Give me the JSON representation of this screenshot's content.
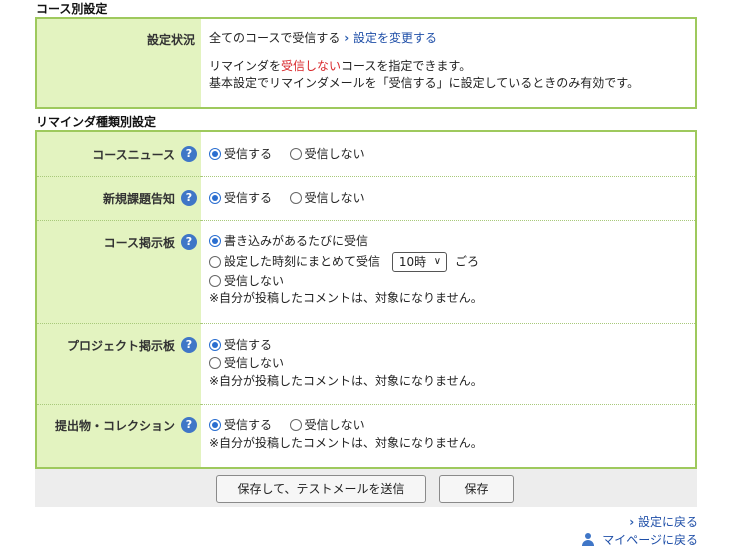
{
  "course_section": {
    "title": "コース別設定",
    "status_label": "設定状況",
    "status_value": "全てのコースで受信する",
    "change_link": "設定を変更する",
    "note1_pre": "リマインダを",
    "note1_red": "受信しない",
    "note1_post": "コースを指定できます。",
    "note2": "基本設定でリマインダメールを「受信する」に設定しているときのみ有効です。"
  },
  "type_section": {
    "title": "リマインダ種類別設定",
    "rows": [
      {
        "label": "コースニュース",
        "options": [
          "受信する",
          "受信しない"
        ],
        "selected": 0
      },
      {
        "label": "新規課題告知",
        "options": [
          "受信する",
          "受信しない"
        ],
        "selected": 0
      },
      {
        "label": "コース掲示板",
        "options": [
          "書き込みがあるたびに受信",
          "設定した時刻にまとめて受信",
          "受信しない"
        ],
        "selected": 0,
        "time_value": "10時",
        "time_suffix": "ごろ",
        "note": "※自分が投稿したコメントは、対象になりません。"
      },
      {
        "label": "プロジェクト掲示板",
        "options": [
          "受信する",
          "受信しない"
        ],
        "selected": 0,
        "note": "※自分が投稿したコメントは、対象になりません。"
      },
      {
        "label": "提出物・コレクション",
        "options": [
          "受信する",
          "受信しない"
        ],
        "selected": 0,
        "note": "※自分が投稿したコメントは、対象になりません。"
      }
    ]
  },
  "buttons": {
    "save_test": "保存して、テストメールを送信",
    "save": "保存"
  },
  "links": {
    "back_settings": "設定に戻る",
    "mypage": "マイページに戻る"
  },
  "help_glyph": "?",
  "colors": {
    "border": "#9ec95d",
    "label_bg": "#e3f3c0",
    "accent": "#2a6ed0",
    "warn": "#d8262a"
  }
}
